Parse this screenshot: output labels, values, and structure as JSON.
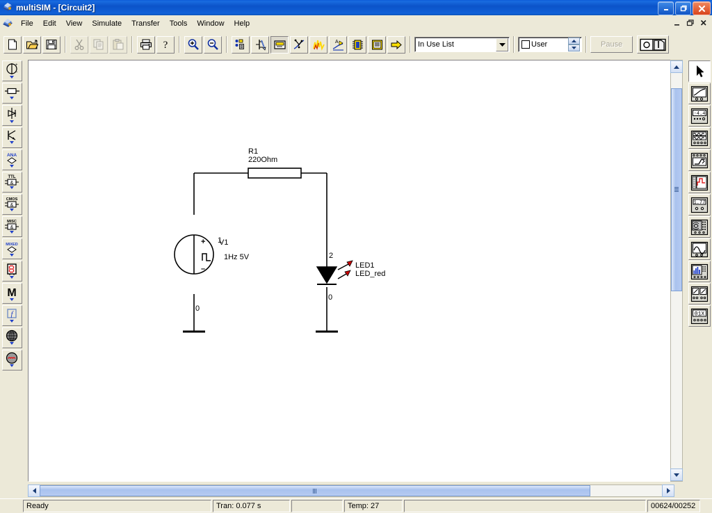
{
  "window": {
    "title": "multiSIM - [Circuit2]",
    "app_icon": "multisim-icon",
    "buttons": {
      "minimize": "_",
      "maximize": "❐",
      "close": "✕"
    }
  },
  "menubar": {
    "doc_icon": "document-icon",
    "items": [
      "File",
      "Edit",
      "View",
      "Simulate",
      "Transfer",
      "Tools",
      "Window",
      "Help"
    ],
    "window_buttons": {
      "minimize": "_",
      "restore": "❐",
      "close": "✕"
    }
  },
  "toolbar": {
    "file_group": [
      {
        "name": "new-file-button",
        "icon": "new-page-icon",
        "enabled": true
      },
      {
        "name": "open-file-button",
        "icon": "open-folder-icon",
        "enabled": true
      },
      {
        "name": "save-file-button",
        "icon": "floppy-disk-icon",
        "enabled": true
      }
    ],
    "edit_group": [
      {
        "name": "cut-button",
        "icon": "scissors-icon",
        "enabled": false
      },
      {
        "name": "copy-button",
        "icon": "copy-icon",
        "enabled": false
      },
      {
        "name": "paste-button",
        "icon": "clipboard-icon",
        "enabled": false
      }
    ],
    "print_group": [
      {
        "name": "print-button",
        "icon": "printer-icon",
        "enabled": true
      },
      {
        "name": "help-button",
        "icon": "question-mark-icon",
        "enabled": true
      }
    ],
    "zoom_group": [
      {
        "name": "zoom-in-button",
        "icon": "magnifier-plus-icon",
        "enabled": true
      },
      {
        "name": "zoom-out-button",
        "icon": "magnifier-minus-icon",
        "enabled": true
      }
    ],
    "design_group": [
      {
        "name": "component-browser-button",
        "icon": "component-database-icon",
        "enabled": true
      },
      {
        "name": "subcircuit-button",
        "icon": "subcircuit-icon",
        "enabled": true
      },
      {
        "name": "simulate-settings-button",
        "icon": "instrument-panel-icon",
        "enabled": true,
        "pressed": true
      },
      {
        "name": "postprocessor-button",
        "icon": "scatter-curve-icon",
        "enabled": true
      },
      {
        "name": "analysis-graph-button",
        "icon": "waveform-graph-icon",
        "enabled": true
      },
      {
        "name": "annotation-button",
        "icon": "text-annotation-icon",
        "enabled": true
      },
      {
        "name": "ic-package-button",
        "icon": "chip-icon",
        "enabled": true
      },
      {
        "name": "report-button",
        "icon": "report-list-icon",
        "enabled": true
      },
      {
        "name": "transfer-button",
        "icon": "yellow-arrow-icon",
        "enabled": true
      }
    ],
    "in_use_list": {
      "name": "in-use-list-combo",
      "value": "In Use List",
      "placeholder": "In Use List"
    },
    "user_field": {
      "name": "user-field",
      "checkbox_checked": false,
      "label": "User"
    },
    "pause_button": {
      "label": "Pause",
      "enabled": false
    },
    "run_switch": {
      "name": "run-stop-switch",
      "icon": "power-switch-icon"
    }
  },
  "left_toolbar": {
    "items": [
      {
        "name": "sources-button",
        "icon": "voltage-source-icon",
        "label": ""
      },
      {
        "name": "basic-components-button",
        "icon": "resistor-icon",
        "label": ""
      },
      {
        "name": "diodes-button",
        "icon": "diode-icon",
        "label": ""
      },
      {
        "name": "transistors-button",
        "icon": "transistor-icon",
        "label": ""
      },
      {
        "name": "analog-ics-button",
        "icon": "analog-ic-icon",
        "label": "ANA"
      },
      {
        "name": "ttl-button",
        "icon": "ttl-gate-icon",
        "label": "TTL"
      },
      {
        "name": "cmos-button",
        "icon": "cmos-gate-icon",
        "label": "CMOS"
      },
      {
        "name": "misc-digital-button",
        "icon": "misc-digital-icon",
        "label": "MISC"
      },
      {
        "name": "mixed-components-button",
        "icon": "mixed-ic-icon",
        "label": "MIXED"
      },
      {
        "name": "indicators-button",
        "icon": "seven-segment-icon",
        "label": ""
      },
      {
        "name": "misc-components-button",
        "icon": "letter-m-icon",
        "label": "M"
      },
      {
        "name": "controls-button",
        "icon": "transfer-function-icon",
        "label": "f"
      },
      {
        "name": "rf-components-button",
        "icon": "rf-globe-icon",
        "label": ""
      },
      {
        "name": "electromechanical-button",
        "icon": "motor-coil-icon",
        "label": ""
      }
    ]
  },
  "right_toolbar": {
    "items": [
      {
        "name": "pointer-tool-button",
        "icon": "arrow-pointer-icon",
        "active": true
      },
      {
        "name": "multimeter-button",
        "icon": "multimeter-icon",
        "active": false
      },
      {
        "name": "function-generator-button",
        "icon": "function-generator-icon",
        "active": false
      },
      {
        "name": "wattmeter-button",
        "icon": "wattmeter-icon",
        "active": false
      },
      {
        "name": "oscilloscope-button",
        "icon": "oscilloscope-icon",
        "active": false
      },
      {
        "name": "bode-plotter-button",
        "icon": "bode-plotter-icon",
        "active": false
      },
      {
        "name": "word-generator-button",
        "icon": "word-generator-icon",
        "active": false
      },
      {
        "name": "logic-analyzer-button",
        "icon": "logic-analyzer-icon",
        "active": false
      },
      {
        "name": "logic-converter-button",
        "icon": "logic-converter-icon",
        "active": false
      },
      {
        "name": "distortion-analyzer-button",
        "icon": "distortion-analyzer-icon",
        "active": false
      },
      {
        "name": "spectrum-analyzer-button",
        "icon": "spectrum-analyzer-icon",
        "active": false
      },
      {
        "name": "network-analyzer-button",
        "icon": "network-analyzer-icon",
        "active": false
      }
    ]
  },
  "canvas": {
    "schematic": {
      "title": "Circuit2",
      "components": [
        {
          "name": "voltage-source-v1",
          "ref": "V1",
          "value": "1Hz  5V",
          "type": "pulse-voltage-source",
          "plus_label": "+",
          "minus_label": "–"
        },
        {
          "name": "resistor-r1",
          "ref": "R1",
          "value": "220Ohm",
          "type": "resistor"
        },
        {
          "name": "led1",
          "ref": "LED1",
          "value": "LED_red",
          "type": "light-emitting-diode",
          "color": "#cc0000"
        }
      ],
      "net_labels": [
        {
          "name": "net-label-1",
          "text": "1"
        },
        {
          "name": "net-label-2",
          "text": "2"
        },
        {
          "name": "net-label-gnd-left",
          "text": "0"
        },
        {
          "name": "net-label-gnd-right",
          "text": "0"
        },
        {
          "name": "net-label-source-gnd",
          "text": "0"
        }
      ]
    }
  },
  "scrollbars": {
    "vertical": {
      "up_arrow": "▲",
      "down_arrow": "▼"
    },
    "horizontal": {
      "left_arrow": "❮",
      "right_arrow": "❯"
    }
  },
  "statusbar": {
    "panels": [
      {
        "name": "status-message",
        "text": "Ready"
      },
      {
        "name": "status-transient",
        "text": "Tran: 0.077 s"
      },
      {
        "name": "status-blank",
        "text": ""
      },
      {
        "name": "status-temperature",
        "text": "Temp: 27"
      },
      {
        "name": "status-spacer",
        "text": ""
      },
      {
        "name": "status-coordinates",
        "text": "00624/00252"
      }
    ]
  },
  "colors": {
    "titlebar_blue": "#0b53c9",
    "chrome": "#ece9d8",
    "canvas_white": "#ffffff",
    "led_red": "#cc0000",
    "accent_yellow": "#ffe000"
  }
}
